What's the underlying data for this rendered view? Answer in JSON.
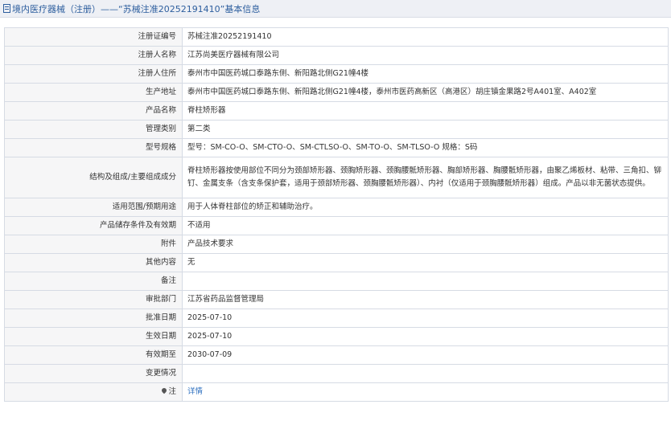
{
  "header": {
    "title": "境内医疗器械（注册）——“苏械注准20252191410”基本信息"
  },
  "rows": [
    {
      "label": "注册证编号",
      "value": "苏械注准20252191410"
    },
    {
      "label": "注册人名称",
      "value": "江苏尚美医疗器械有限公司"
    },
    {
      "label": "注册人住所",
      "value": "泰州市中国医药城口泰路东侧、新阳路北侧G21幢4楼"
    },
    {
      "label": "生产地址",
      "value": "泰州市中国医药城口泰路东侧、新阳路北侧G21幢4楼，泰州市医药高新区（高港区）胡庄镇金果路2号A401室、A402室"
    },
    {
      "label": "产品名称",
      "value": "脊柱矫形器"
    },
    {
      "label": "管理类别",
      "value": "第二类"
    },
    {
      "label": "型号规格",
      "value": "型号：SM-CO-O、SM-CTO-O、SM-CTLSO-O、SM-TO-O、SM-TLSO-O 规格：S码"
    },
    {
      "label": "结构及组成/主要组成成分",
      "value": "脊柱矫形器按使用部位不同分为颈部矫形器、颈胸矫形器、颈胸腰骶矫形器、胸部矫形器、胸腰骶矫形器，由聚乙烯板材、粘带、三角扣、铆钉、金属支条（含支条保护套，适用于颈部矫形器、颈胸腰骶矫形器）、内衬（仅适用于颈胸腰骶矫形器）组成。产品以非无菌状态提供。"
    },
    {
      "label": "适用范围/预期用途",
      "value": "用于人体脊柱部位的矫正和辅助治疗。"
    },
    {
      "label": "产品储存条件及有效期",
      "value": "不适用"
    },
    {
      "label": "附件",
      "value": "产品技术要求"
    },
    {
      "label": "其他内容",
      "value": "无"
    },
    {
      "label": "备注",
      "value": ""
    },
    {
      "label": "审批部门",
      "value": "江苏省药品监督管理局"
    },
    {
      "label": "批准日期",
      "value": "2025-07-10"
    },
    {
      "label": "生效日期",
      "value": "2025-07-10"
    },
    {
      "label": "有效期至",
      "value": "2030-07-09"
    },
    {
      "label": "变更情况",
      "value": ""
    },
    {
      "label": "注",
      "value": "详情",
      "icon": "pin-icon"
    }
  ],
  "colors": {
    "header_bg": "#eef0f5",
    "title_blue": "#2d5e9e",
    "label_bg": "#f6f6f7",
    "border": "#d6dbe4",
    "link": "#2d6fbf"
  }
}
